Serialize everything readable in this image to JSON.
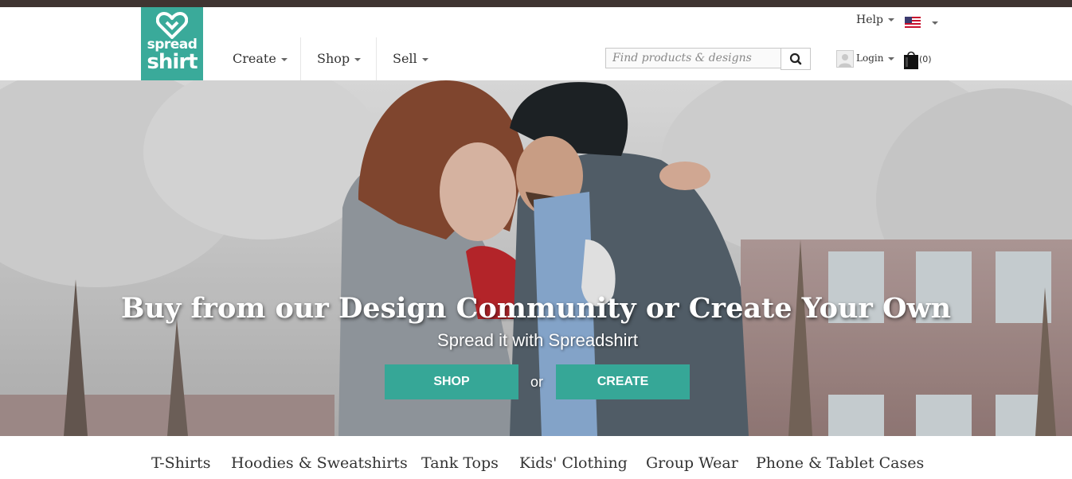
{
  "brand": {
    "line1": "spread",
    "line2": "shirt",
    "color": "#3aaa9a"
  },
  "nav": {
    "items": [
      {
        "label": "Create"
      },
      {
        "label": "Shop"
      },
      {
        "label": "Sell"
      }
    ]
  },
  "utility": {
    "help_label": "Help",
    "locale_flag": "us-flag-icon",
    "search_placeholder": "Find products & designs",
    "search_value": "",
    "login_label": "Login",
    "cart_count": "(0)"
  },
  "hero": {
    "title": "Buy from our Design Community or Create Your Own",
    "subtitle": "Spread it with Spreadshirt",
    "shop_button": "SHOP",
    "or_text": "or",
    "create_button": "CREATE",
    "button_color": "#36a797"
  },
  "categories": [
    "T-Shirts",
    "Hoodies & Sweatshirts",
    "Tank Tops",
    "Kids' Clothing",
    "Group Wear",
    "Phone & Tablet Cases"
  ]
}
